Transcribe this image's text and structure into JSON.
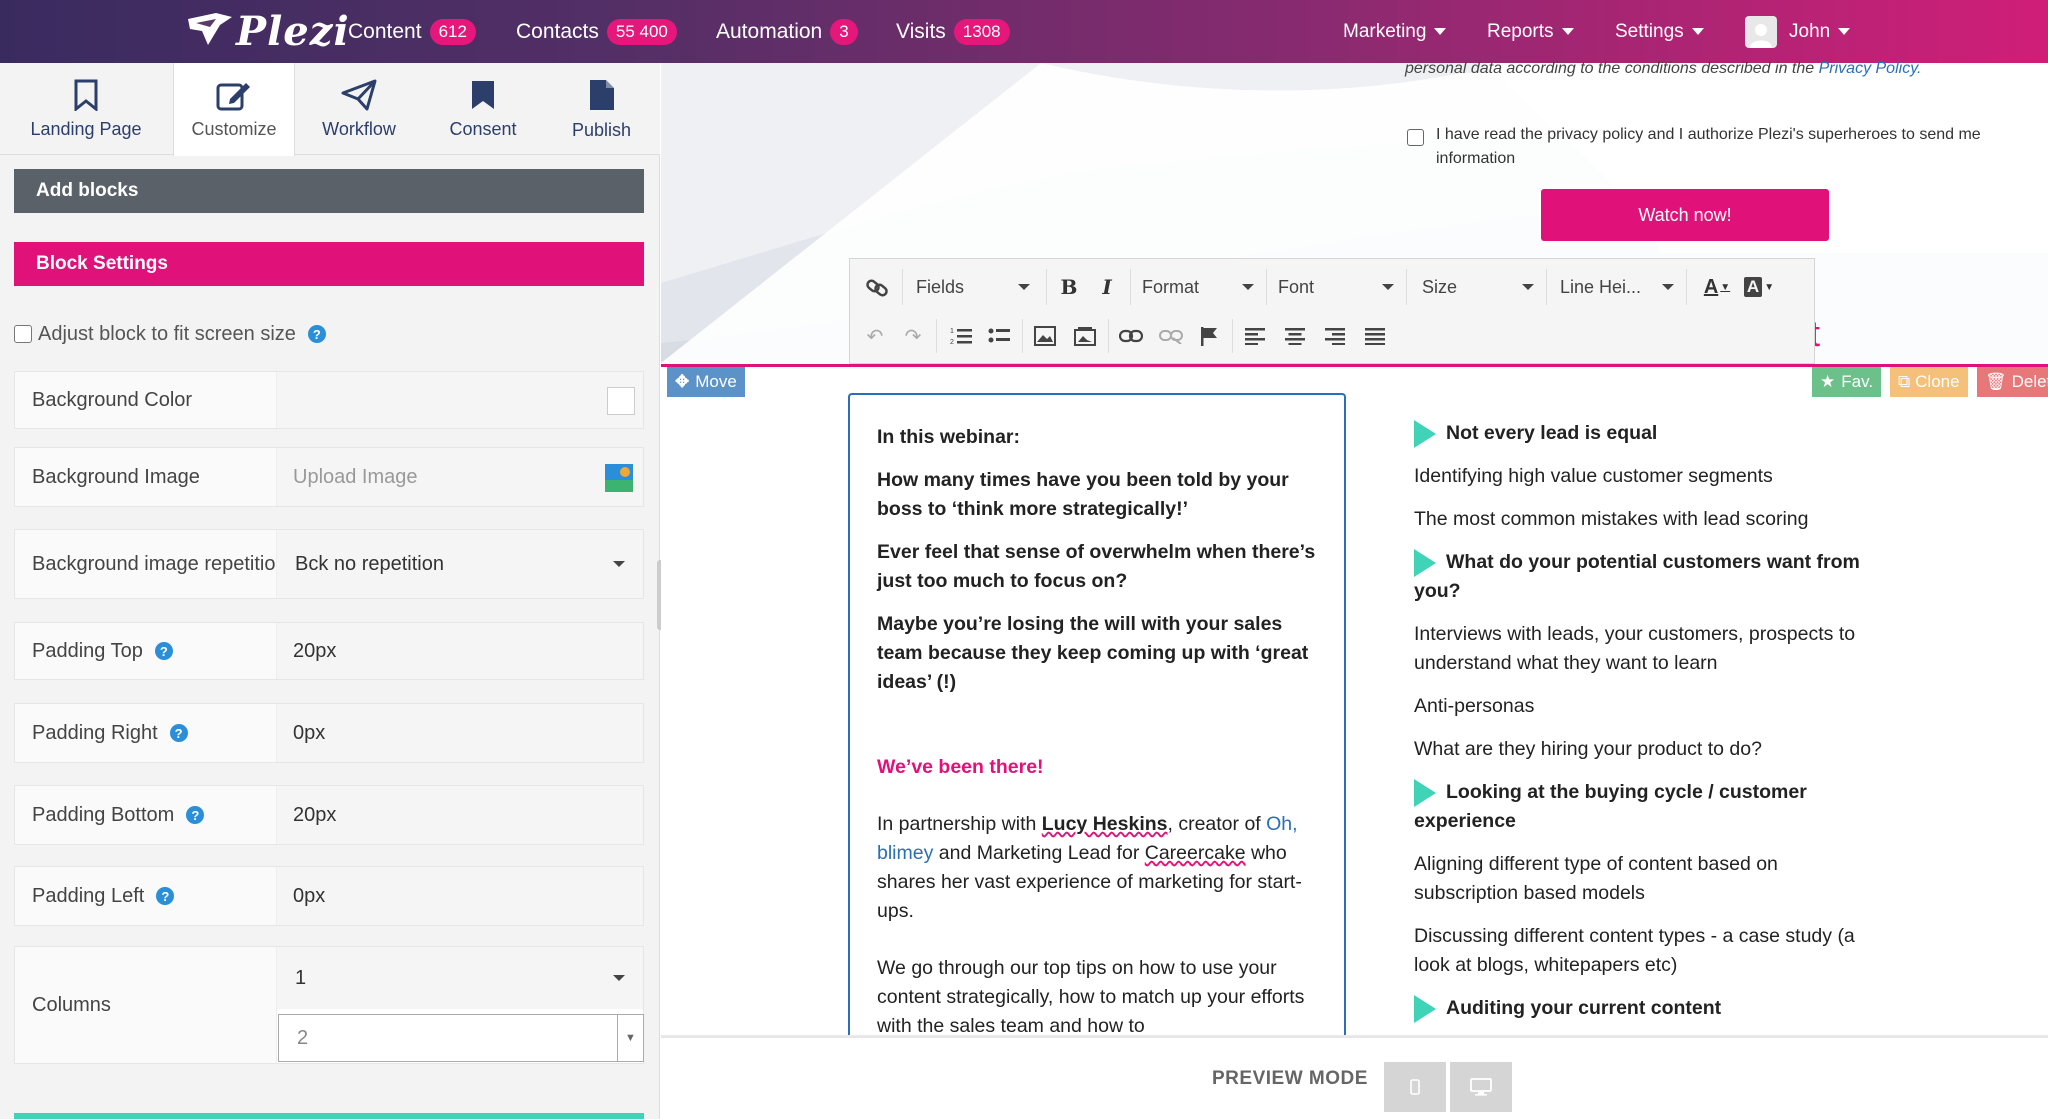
{
  "nav": {
    "logo": "Plezi",
    "items": [
      {
        "label": "Content",
        "count": "612"
      },
      {
        "label": "Contacts",
        "count": "55 400"
      },
      {
        "label": "Automation",
        "count": "3"
      },
      {
        "label": "Visits",
        "count": "1308"
      }
    ],
    "menus": [
      {
        "label": "Marketing"
      },
      {
        "label": "Reports"
      },
      {
        "label": "Settings"
      }
    ],
    "user": "John"
  },
  "tabs": [
    {
      "label": "Landing Page",
      "icon": "bookmark-outline-icon"
    },
    {
      "label": "Customize",
      "icon": "edit-icon"
    },
    {
      "label": "Workflow",
      "icon": "paper-plane-icon"
    },
    {
      "label": "Consent",
      "icon": "bookmark-icon"
    },
    {
      "label": "Publish",
      "icon": "file-icon"
    }
  ],
  "panel": {
    "add_blocks": "Add blocks",
    "block_settings": "Block Settings",
    "adjust_label": "Adjust block to fit screen size",
    "help": "?",
    "bg_color_label": "Background Color",
    "bg_image_label": "Background Image",
    "bg_image_placeholder": "Upload Image",
    "bg_repeat_label": "Background image repetitio",
    "bg_repeat_value": "Bck no repetition",
    "padding_top_label": "Padding Top",
    "padding_top_value": "20px",
    "padding_right_label": "Padding Right",
    "padding_right_value": "0px",
    "padding_bottom_label": "Padding Bottom",
    "padding_bottom_value": "20px",
    "padding_left_label": "Padding Left",
    "padding_left_value": "0px",
    "columns_label": "Columns",
    "columns_value": "1",
    "columns_input": "2"
  },
  "form": {
    "privacy_text": "personal data according to the conditions described in the",
    "privacy_link": "Privacy Policy.",
    "consent_label": "I have read the privacy policy and I authorize Plezi's superheroes to send me information",
    "watch_button": "Watch now!"
  },
  "toolbar": {
    "fields": "Fields",
    "format": "Format",
    "font": "Font",
    "size": "Size",
    "line_height": "Line Hei..."
  },
  "block": {
    "move": "Move",
    "fav": "Fav.",
    "clone": "Clone",
    "delete": "Delete",
    "stray_char": "t"
  },
  "left_col": {
    "intro": "In this webinar:",
    "p1": "How many times have you been told by your boss to ‘think more strategically!’",
    "p2": "Ever feel that sense of overwhelm when there’s just too much to focus on?",
    "p3": "Maybe you’re losing the will with your sales team because they keep coming up with ‘great ideas’ (!)",
    "headline": "We’ve been there!",
    "p4_a": "In partnership with ",
    "p4_name": "Lucy Heskins",
    "p4_b": ", creator of ",
    "p4_link": "Oh, blimey",
    "p4_c": " and Marketing Lead for ",
    "p4_company": "Careercake",
    "p4_d": " who shares her vast experience of marketing for start-ups.",
    "p5": "We go through our top tips on how to use your content strategically, how to match up your efforts with the sales team and how to"
  },
  "right_col": [
    {
      "type": "heading",
      "text": "Not every lead is equal"
    },
    {
      "type": "item",
      "text": "Identifying high value customer segments"
    },
    {
      "type": "item",
      "text": "The most common mistakes with lead scoring"
    },
    {
      "type": "heading",
      "text": "What do your potential customers want from you?"
    },
    {
      "type": "item",
      "text": "Interviews with leads, your customers, prospects to understand what they want to learn"
    },
    {
      "type": "item",
      "text": "Anti-personas"
    },
    {
      "type": "item",
      "text": "What are they hiring your product to do?"
    },
    {
      "type": "heading",
      "text": "Looking at the buying cycle / customer experience"
    },
    {
      "type": "item",
      "text": "Aligning different type of content based on subscription based models"
    },
    {
      "type": "item",
      "text": "Discussing different content types - a case study (a look at blogs, whitepapers etc)"
    },
    {
      "type": "heading",
      "text": "Auditing your current content"
    }
  ],
  "preview": {
    "label": "PREVIEW MODE"
  },
  "colors": {
    "accent": "#e0127a",
    "teal": "#3fd3b8",
    "dark": "#5b6168",
    "link": "#2a6fb8"
  }
}
